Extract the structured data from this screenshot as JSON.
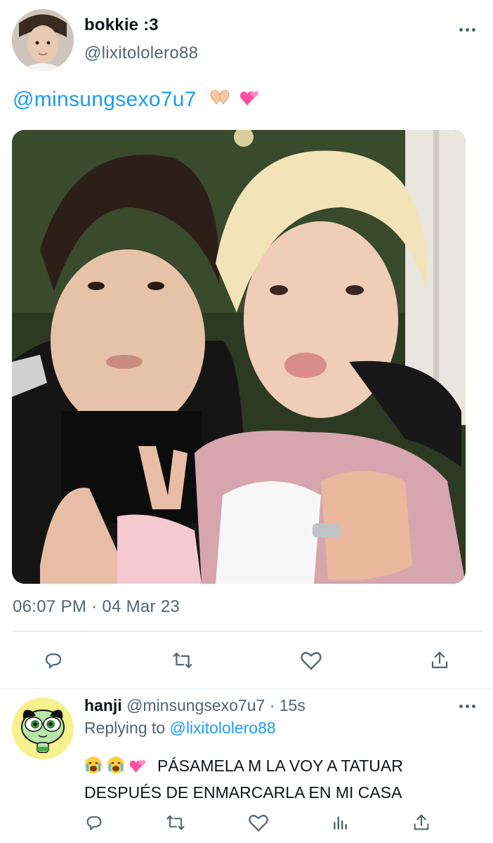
{
  "tweet": {
    "display_name": "bokkie :3",
    "handle": "@lixitololero88",
    "text": "@minsungsexo7u7",
    "emojis": [
      "hands-heart-emoji",
      "two-hearts-emoji"
    ],
    "timestamp": "06:07 PM · 04 Mar 23",
    "actions": [
      "reply-icon",
      "retweet-icon",
      "like-icon",
      "share-icon"
    ]
  },
  "reply": {
    "display_name": "hanji",
    "handle": "@minsungsexo7u7",
    "separator": "·",
    "time": "15s",
    "replying_label": "Replying to",
    "replying_handle": "@lixitololero88",
    "text": "PÁSAMELA M LA VOY A TATUAR DESPUÉS DE ENMARCARLA EN MI CASA",
    "emojis": [
      "crying-face-emoji",
      "crying-face-emoji",
      "two-hearts-emoji"
    ],
    "actions": [
      "reply-icon",
      "retweet-icon",
      "like-icon",
      "analytics-icon",
      "share-icon"
    ]
  },
  "colors": {
    "link": "#1d9bf0",
    "secondary_text": "#536471",
    "divider": "#cfd9de"
  }
}
